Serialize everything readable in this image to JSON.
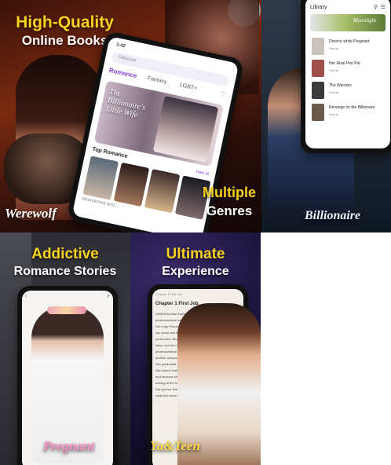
{
  "panels": {
    "p1": {
      "headline_line1": "High-Quality",
      "headline_line2": "Online Books",
      "genre_left": "Werewolf",
      "headline_multiple": "Multiple",
      "headline_genres": "Genres",
      "phone": {
        "time": "1:42",
        "search_placeholder": "Discover",
        "tabs": [
          "Romance",
          "Fantasy",
          "LGBT+"
        ],
        "banner_title": "The Billionaire's Little Wife",
        "section": "Top Romance",
        "view_all": "View all",
        "book1": "Abandoned and..."
      }
    },
    "p2": {
      "genre": "Billionaire",
      "phone": {
        "header": "Library",
        "featured_title": "Moonlight",
        "list": [
          {
            "title": "Divorce while Pregnant",
            "sub": "Drama"
          },
          {
            "title": "Her Rival Pen Pal",
            "sub": "Drama"
          },
          {
            "title": "The Warriors",
            "sub": "Drama"
          },
          {
            "title": "Revenge on the Billionaire",
            "sub": "Drama"
          }
        ]
      }
    },
    "p3": {
      "headline_line1": "Addictive",
      "headline_line2": "Romance Stories",
      "genre": "Pregnant"
    },
    "p4": {
      "headline_line1": "Ultimate",
      "headline_line2": "Experience",
      "genre": "Ya&Teen",
      "phone": {
        "chapter_header": "Chapter 1 First Job",
        "chapter_title": "Chapter 1 First Job",
        "body": [
          "VANESSA Mae Abella started working at",
          "pharmaceutical sales representative at",
          "Gen-Hap Pharma. She has been working",
          "two years and has been one of the top",
          "performers. Because of that, she has",
          "twice, and she has been promoted to",
          "pharmaceutical company that is in",
          "another company downtown.",
          "She graduated with Bachelor's",
          "She wasn't really interested in the",
          "and because she is the...",
          "smiling at the flowers she has...",
          "She got her first job when she turned",
          "what she used to do."
        ]
      }
    }
  }
}
